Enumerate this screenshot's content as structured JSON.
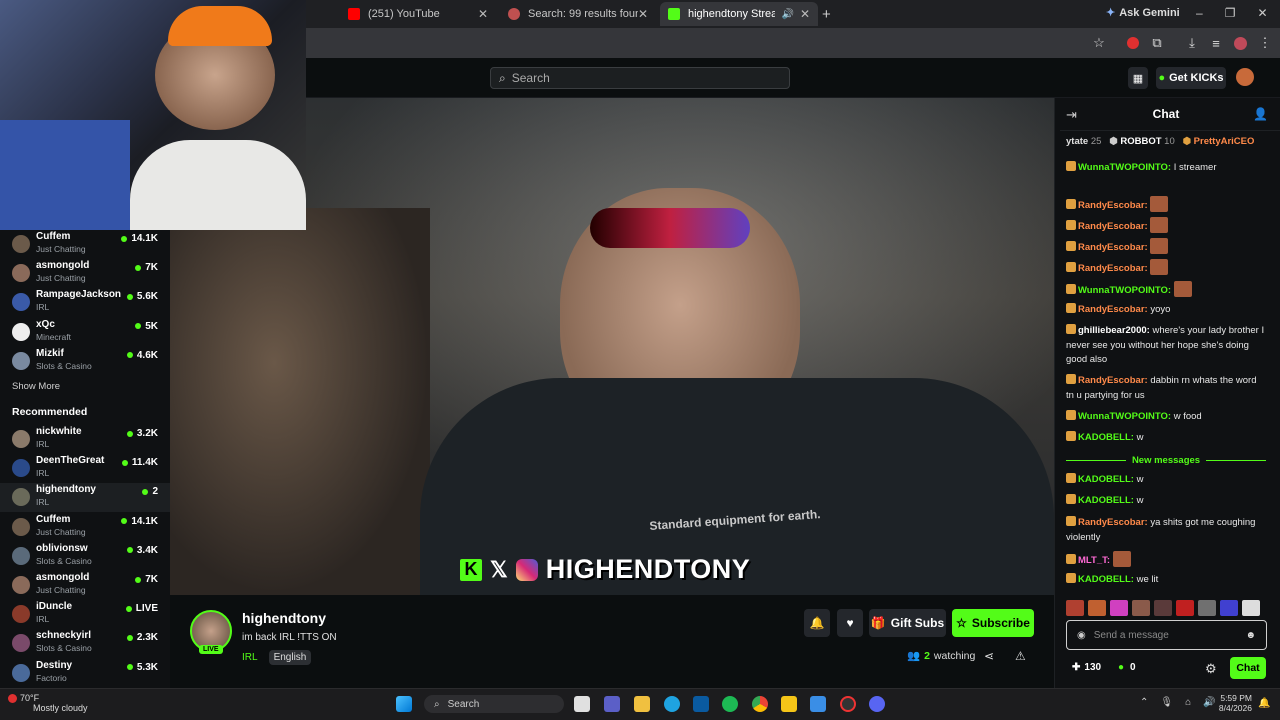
{
  "browser": {
    "tabs": [
      {
        "title": "(251) YouTube"
      },
      {
        "title": "Search: 99 results found for \"pr"
      },
      {
        "title": "highendtony Stream - Watc"
      }
    ],
    "ask_gemini": "Ask Gemini"
  },
  "kick_header": {
    "search_placeholder": "Search",
    "get_kicks": "Get KICKs"
  },
  "sidebar": {
    "following": [
      {
        "name": "Cuffem",
        "category": "Just Chatting",
        "viewers": "14.1K",
        "color": "#6b5a4a"
      },
      {
        "name": "asmongold",
        "category": "Just Chatting",
        "viewers": "7K",
        "color": "#8a6a5a"
      },
      {
        "name": "RampageJackson",
        "category": "IRL",
        "viewers": "5.6K",
        "color": "#3a5aa8"
      },
      {
        "name": "xQc",
        "category": "Minecraft",
        "viewers": "5K",
        "color": "#eeeeee"
      },
      {
        "name": "Mizkif",
        "category": "Slots & Casino",
        "viewers": "4.6K",
        "color": "#7a8aa0"
      }
    ],
    "show_more": "Show More",
    "recommended_title": "Recommended",
    "recommended": [
      {
        "name": "nickwhite",
        "category": "IRL",
        "viewers": "3.2K",
        "color": "#8a7a6a"
      },
      {
        "name": "DeenTheGreat",
        "category": "IRL",
        "viewers": "11.4K",
        "color": "#2a4a8a"
      },
      {
        "name": "highendtony",
        "category": "IRL",
        "viewers": "2",
        "color": "#6a6a5a"
      },
      {
        "name": "Cuffem",
        "category": "Just Chatting",
        "viewers": "14.1K",
        "color": "#6b5a4a"
      },
      {
        "name": "oblivionsw",
        "category": "Slots & Casino",
        "viewers": "3.4K",
        "color": "#5a6a7a"
      },
      {
        "name": "asmongold",
        "category": "Just Chatting",
        "viewers": "7K",
        "color": "#8a6a5a"
      },
      {
        "name": "iDuncle",
        "category": "IRL",
        "viewers": "LIVE",
        "color": "#8a3a2a"
      },
      {
        "name": "schneckyirl",
        "category": "Slots & Casino",
        "viewers": "2.3K",
        "color": "#7a4a6a"
      },
      {
        "name": "Destiny",
        "category": "Factorio",
        "viewers": "5.3K",
        "color": "#4a6a9a"
      }
    ]
  },
  "video": {
    "overlay_name": "HIGHENDTONY",
    "shirt_text": "Standard equipment for earth."
  },
  "stream_info": {
    "streamer": "highendtony",
    "live_label": "LIVE",
    "title": "im back IRL !TTS ON",
    "category": "IRL",
    "language": "English",
    "watching_count": "2",
    "watching_label": "watching",
    "gift_subs": "Gift Subs",
    "subscribe": "Subscribe"
  },
  "chat": {
    "title": "Chat",
    "top_gifters": [
      {
        "name": "ytate",
        "count": "25"
      },
      {
        "name": "ROBBOT",
        "count": "10"
      },
      {
        "name": "PrettyAriCEO",
        "count": "3"
      }
    ],
    "messages": [
      {
        "user": "WunnaTWOPOINTO",
        "text": "I streamer",
        "color": "#53fc18"
      },
      {
        "user": "RandyEscobar",
        "text": "",
        "color": "#ff8a4a"
      },
      {
        "user": "RandyEscobar",
        "text": "",
        "color": "#ff8a4a"
      },
      {
        "user": "RandyEscobar",
        "text": "",
        "color": "#ff8a4a"
      },
      {
        "user": "RandyEscobar",
        "text": "",
        "color": "#ff8a4a"
      },
      {
        "user": "WunnaTWOPOINTO",
        "text": "",
        "color": "#53fc18"
      },
      {
        "user": "RandyEscobar",
        "text": "yoyo",
        "color": "#ff8a4a"
      },
      {
        "user": "ghilliebear2000",
        "text": "where's your lady brother I never see you without her hope she's doing good also",
        "color": "#ffffff"
      },
      {
        "user": "RandyEscobar",
        "text": "dabbin rn whats the word tn u partying for us",
        "color": "#ff8a4a"
      },
      {
        "user": "WunnaTWOPOINTO",
        "text": "w food",
        "color": "#53fc18"
      },
      {
        "user": "KADOBELL",
        "text": "w",
        "color": "#53fc18"
      }
    ],
    "new_messages_label": "New messages",
    "new_messages": [
      {
        "user": "KADOBELL",
        "text": "w",
        "color": "#53fc18"
      },
      {
        "user": "KADOBELL",
        "text": "w",
        "color": "#53fc18"
      },
      {
        "user": "RandyEscobar",
        "text": "ya shits got me coughing violently",
        "color": "#ff8a4a"
      },
      {
        "user": "MLT_T",
        "text": "",
        "color": "#ff6ad5"
      },
      {
        "user": "KADOBELL",
        "text": "we lit",
        "color": "#53fc18"
      }
    ],
    "input_placeholder": "Send a message",
    "points": "130",
    "kicks": "0",
    "send_label": "Chat"
  },
  "taskbar": {
    "weather_temp": "70°F",
    "weather_desc": "Mostly cloudy",
    "search_label": "Search",
    "time": "5:59 PM",
    "date": "8/4/2026"
  }
}
